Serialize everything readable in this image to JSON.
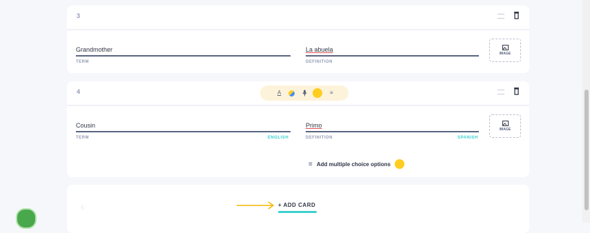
{
  "cards": [
    {
      "number": "3",
      "term": "Grandmother",
      "term_label": "TERM",
      "definition": "La abuela",
      "definition_label": "DEFINITION",
      "image_label": "IMAGE"
    },
    {
      "number": "4",
      "term": "Cousin",
      "term_label": "TERM",
      "term_lang": "ENGLISH",
      "definition": "Primo",
      "definition_label": "DEFINITION",
      "definition_lang": "SPANISH",
      "image_label": "IMAGE",
      "add_mc_label": "Add multiple choice options"
    }
  ],
  "add_card": {
    "number": "5",
    "label": "+ ADD CARD"
  },
  "colors": {
    "accent": "#3ccfcf",
    "lock": "#ffcd1f",
    "arrow": "#f5b700",
    "help": "#49a84b"
  },
  "icons": [
    "drag-handle-icon",
    "trash-icon",
    "image-icon",
    "text-style-icon",
    "color-icon",
    "microphone-icon",
    "lock-icon",
    "list-add-icon",
    "chat-help-icon"
  ]
}
